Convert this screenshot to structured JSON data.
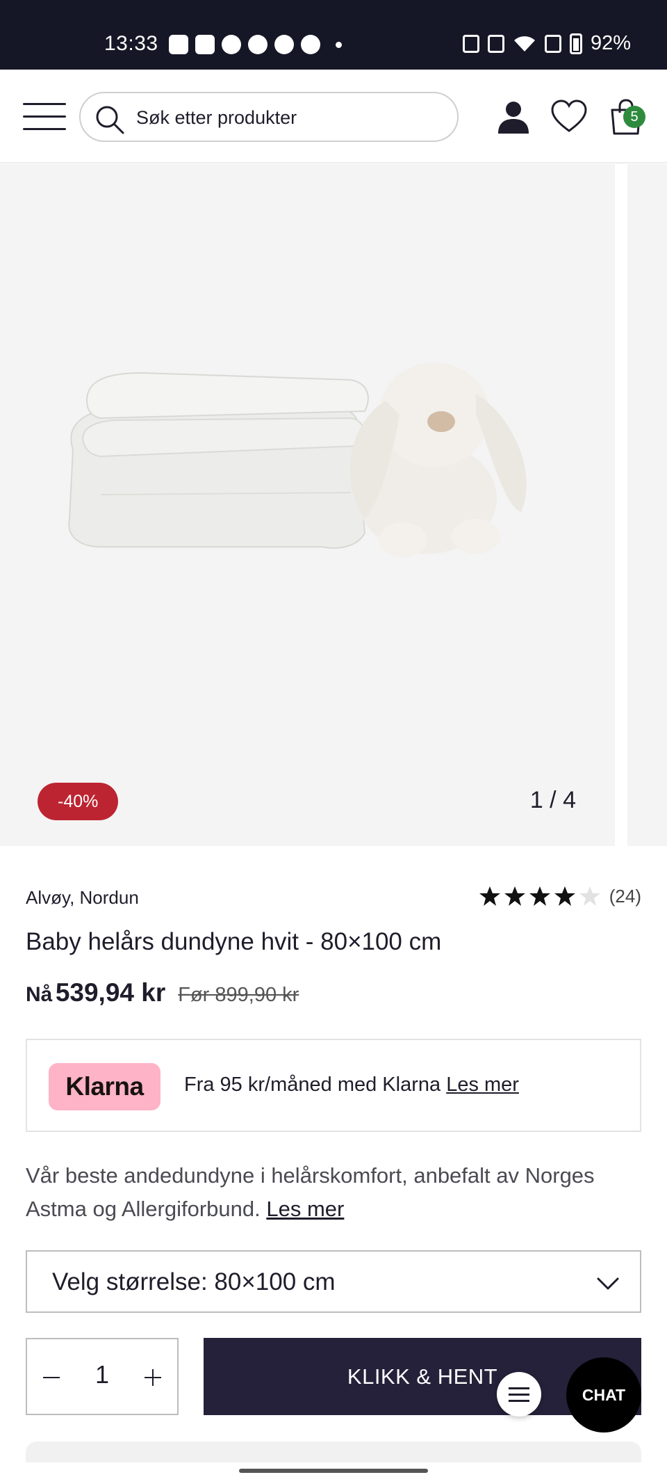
{
  "status_bar": {
    "time": "13:33",
    "battery": "92%",
    "left_icons": [
      "bereal-icon",
      "gmail-icon",
      "hm-icon",
      "messenger-icon",
      "stack-icon",
      "bolt-icon"
    ],
    "right_icons": [
      "nfc-icon",
      "vibrate-icon",
      "wifi-icon",
      "no-sim-icon",
      "battery-icon"
    ]
  },
  "header": {
    "search_placeholder": "Søk etter produkter",
    "cart_count": "5",
    "icons": [
      "menu-icon",
      "search-icon",
      "account-icon",
      "heart-icon",
      "cart-icon"
    ]
  },
  "gallery": {
    "discount": "-40%",
    "counter": "1 / 4"
  },
  "product": {
    "brand": "Alvøy, Nordun",
    "rating_value": 4,
    "rating_max": 5,
    "rating_count": "(24)",
    "title": "Baby helårs dundyne hvit - 80×100 cm",
    "price_now_label": "Nå",
    "price_now": "539,94 kr",
    "price_was": "Før 899,90 kr"
  },
  "klarna": {
    "logo": "Klarna",
    "text": "Fra 95 kr/måned med Klarna",
    "link": "Les mer"
  },
  "description": {
    "text": "Vår beste andedundyne i helårskomfort, anbefalt av Norges Astma og Allergiforbund.",
    "link": "Les mer"
  },
  "size_select": {
    "label": "Velg størrelse: 80×100 cm"
  },
  "purchase": {
    "quantity": "1",
    "cta_label": "KLIKK & HENT"
  },
  "chat": {
    "label": "CHAT"
  },
  "colors": {
    "status_bar": "#151726",
    "discount_badge": "#bd2431",
    "cart_badge": "#2e8b3e",
    "klarna_pink": "#ffb3c7",
    "cta": "#25213a"
  }
}
